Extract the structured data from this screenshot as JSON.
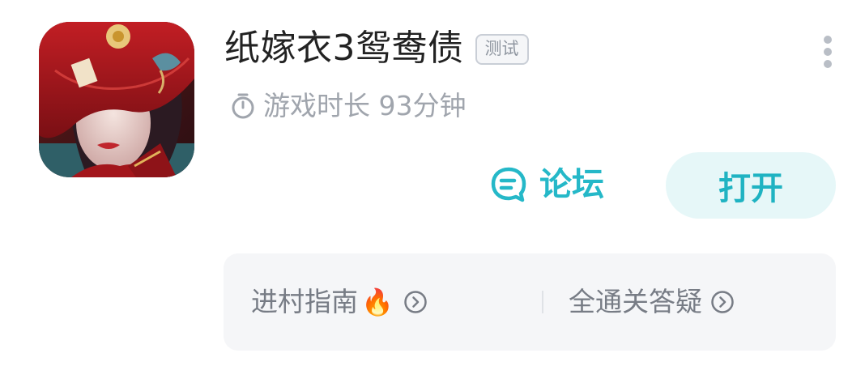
{
  "app": {
    "title": "纸嫁衣3鸳鸯债",
    "badge": "测试",
    "icon": "game-cover-art"
  },
  "playtime": {
    "label": "游戏时长 93分钟",
    "icon": "stopwatch-icon"
  },
  "actions": {
    "forum_label": "论坛",
    "open_label": "打开"
  },
  "guides": [
    {
      "label": "进村指南",
      "emoji": "🔥",
      "icon": "chevron-right-circle-icon"
    },
    {
      "label": "全通关答疑",
      "icon": "chevron-right-circle-icon"
    }
  ],
  "colors": {
    "accent": "#25b8c8",
    "button_bg": "#e6f7f8",
    "muted_text": "#a0a5ad",
    "card_bg": "#f5f6f8"
  }
}
